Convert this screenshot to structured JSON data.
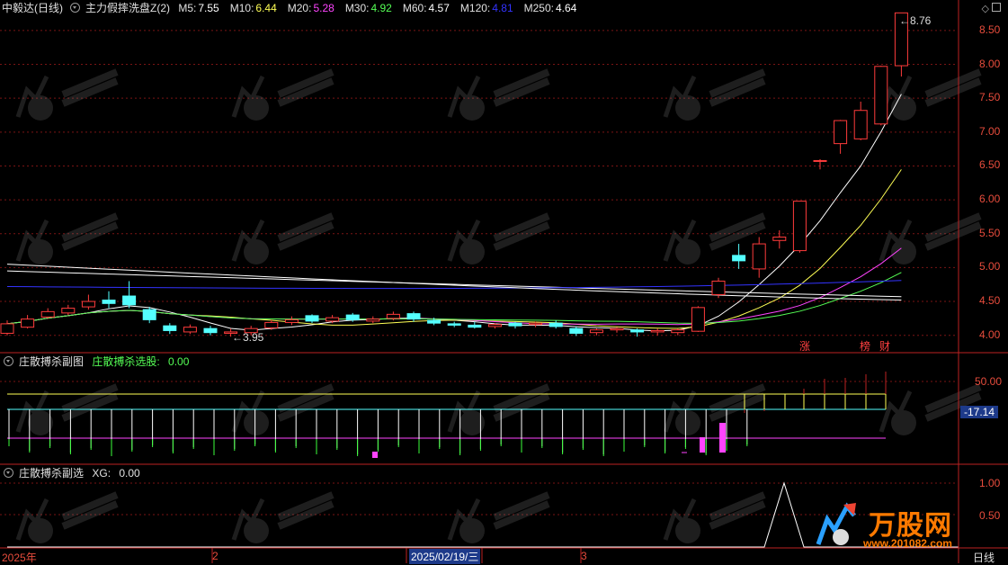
{
  "main_header": {
    "stock": "中毅达(日线)",
    "indicator": "主力假摔洗盘Z(2)",
    "ma": [
      {
        "label": "M5:",
        "value": "7.55",
        "color": "#ffffff"
      },
      {
        "label": "M10:",
        "value": "6.44",
        "color": "#ffff55"
      },
      {
        "label": "M20:",
        "value": "5.28",
        "color": "#ff44ff"
      },
      {
        "label": "M30:",
        "value": "4.92",
        "color": "#55ff55"
      },
      {
        "label": "M60:",
        "value": "4.57",
        "color": "#ffffff"
      },
      {
        "label": "M120:",
        "value": "4.81",
        "color": "#3333ff"
      },
      {
        "label": "M250:",
        "value": "4.64",
        "color": "#ffffff"
      }
    ]
  },
  "sub1_header": {
    "name": "庄散搏杀副图",
    "label": "庄散搏杀选股:",
    "value": "0.00"
  },
  "sub2_header": {
    "name": "庄散搏杀副选",
    "label": "XG:",
    "value": "0.00"
  },
  "price_axis": [
    "8.50",
    "8.00",
    "7.50",
    "7.00",
    "6.50",
    "6.00",
    "5.50",
    "5.00",
    "4.50",
    "4.00"
  ],
  "sub1_axis": {
    "top": "50.00",
    "current": "-17.14"
  },
  "sub2_axis": [
    "1.00",
    "0.50"
  ],
  "annotations": {
    "high": "8.76",
    "low": "3.95",
    "tags": [
      "涨",
      "榜",
      "财"
    ]
  },
  "timeline": {
    "year": "2025年",
    "m2": "2",
    "date": "2025/02/19/三",
    "m3": "3",
    "period": "日线"
  },
  "watermark": {
    "brand": "万股网",
    "url": "www.201082.com"
  },
  "chart_data": {
    "type": "candlestick",
    "ylim": [
      3.85,
      8.95
    ],
    "candles": [
      [
        4.03,
        4.17,
        4.0,
        4.22
      ],
      [
        4.12,
        4.24,
        4.1,
        4.3
      ],
      [
        4.27,
        4.35,
        4.25,
        4.4
      ],
      [
        4.33,
        4.4,
        4.3,
        4.45
      ],
      [
        4.42,
        4.5,
        4.38,
        4.6
      ],
      [
        4.52,
        4.47,
        4.4,
        4.65
      ],
      [
        4.58,
        4.45,
        4.4,
        4.8
      ],
      [
        4.38,
        4.23,
        4.18,
        4.42
      ],
      [
        4.14,
        4.07,
        4.02,
        4.18
      ],
      [
        4.05,
        4.12,
        4.02,
        4.16
      ],
      [
        4.1,
        4.04,
        4.0,
        4.14
      ],
      [
        4.03,
        4.05,
        3.98,
        4.1
      ],
      [
        4.04,
        4.1,
        4.0,
        4.14
      ],
      [
        4.11,
        4.19,
        4.08,
        4.23
      ],
      [
        4.19,
        4.23,
        4.15,
        4.28
      ],
      [
        4.29,
        4.21,
        4.18,
        4.31
      ],
      [
        4.21,
        4.26,
        4.18,
        4.3
      ],
      [
        4.3,
        4.23,
        4.2,
        4.33
      ],
      [
        4.21,
        4.24,
        4.18,
        4.28
      ],
      [
        4.25,
        4.31,
        4.22,
        4.35
      ],
      [
        4.32,
        4.24,
        4.2,
        4.35
      ],
      [
        4.22,
        4.18,
        4.15,
        4.26
      ],
      [
        4.17,
        4.15,
        4.12,
        4.2
      ],
      [
        4.15,
        4.12,
        4.1,
        4.2
      ],
      [
        4.13,
        4.16,
        4.1,
        4.18
      ],
      [
        4.18,
        4.14,
        4.1,
        4.2
      ],
      [
        4.16,
        4.18,
        4.12,
        4.2
      ],
      [
        4.18,
        4.13,
        4.1,
        4.22
      ],
      [
        4.1,
        4.03,
        3.99,
        4.13
      ],
      [
        4.04,
        4.08,
        4.0,
        4.1
      ],
      [
        4.08,
        4.1,
        4.04,
        4.12
      ],
      [
        4.08,
        4.05,
        3.98,
        4.1
      ],
      [
        4.05,
        4.07,
        4.0,
        4.1
      ],
      [
        4.04,
        4.08,
        4.0,
        4.1
      ],
      [
        4.06,
        4.41,
        4.05,
        4.43
      ],
      [
        4.6,
        4.8,
        4.55,
        4.85
      ],
      [
        5.18,
        5.1,
        4.98,
        5.35
      ],
      [
        4.98,
        5.35,
        4.85,
        5.45
      ],
      [
        5.4,
        5.45,
        5.28,
        5.55
      ],
      [
        5.25,
        5.98,
        5.22,
        5.98
      ],
      [
        6.57,
        6.58,
        6.45,
        6.6
      ],
      [
        6.83,
        7.17,
        6.68,
        7.18
      ],
      [
        6.9,
        7.32,
        6.88,
        7.45
      ],
      [
        7.12,
        7.97,
        7.1,
        7.98
      ],
      [
        7.98,
        8.76,
        7.82,
        8.76
      ]
    ]
  }
}
